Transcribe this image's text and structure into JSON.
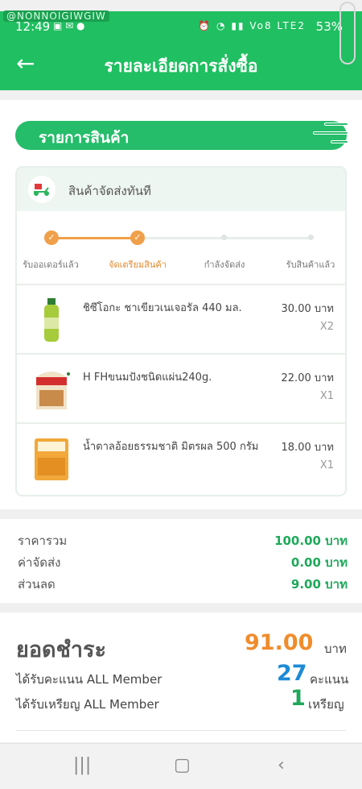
{
  "status_bar": {
    "time": "12:49",
    "watermark": "@NONNOIGIWGIW",
    "network": "Vo8 LTE2",
    "battery": "53%"
  },
  "header": {
    "title": "รายละเอียดการสั่งซื้อ",
    "back_icon": "arrow-left-icon"
  },
  "section": {
    "title": "รายการสินค้า"
  },
  "shipment": {
    "label": "สินค้าจัดส่งทันที",
    "icon": "scooter-icon"
  },
  "steps": [
    {
      "label": "รับออเดอร์แล้ว",
      "state": "done"
    },
    {
      "label": "จัดเตรียมสินค้า",
      "state": "current"
    },
    {
      "label": "กำลังจัดส่ง",
      "state": "pending"
    },
    {
      "label": "รับสินค้าแล้ว",
      "state": "pending"
    }
  ],
  "items": [
    {
      "name": "ชิซึโอกะ ชาเขียวเนเจอรัล 440 มล.",
      "price": "30.00 บาท",
      "qty": "X2"
    },
    {
      "name": "H FHขนมปังชนิดแผ่น240g.",
      "price": "22.00 บาท",
      "qty": "X1"
    },
    {
      "name": "น้ำตาลอ้อยธรรมชาติ มิตรผล 500 กรัม",
      "price": "18.00 บาท",
      "qty": "X1"
    }
  ],
  "summary": {
    "total_label": "ราคารวม",
    "total_value": "100.00 บาท",
    "shipping_label": "ค่าจัดส่ง",
    "shipping_value": "0.00 บาท",
    "discount_label": "ส่วนลด",
    "discount_value": "9.00 บาท"
  },
  "payment": {
    "label": "ยอดชำระ",
    "amount": "91.00",
    "unit": "บาท",
    "points_label": "ได้รับคะแนน ALL Member",
    "points_value": "27",
    "points_unit": "คะแนน",
    "coins_label": "ได้รับเหรียญ ALL Member",
    "coins_value": "1",
    "coins_unit": "เหรียญ"
  },
  "colors": {
    "primary": "#20bf61",
    "accent": "#f08c2c",
    "points": "#1d8bd6"
  }
}
